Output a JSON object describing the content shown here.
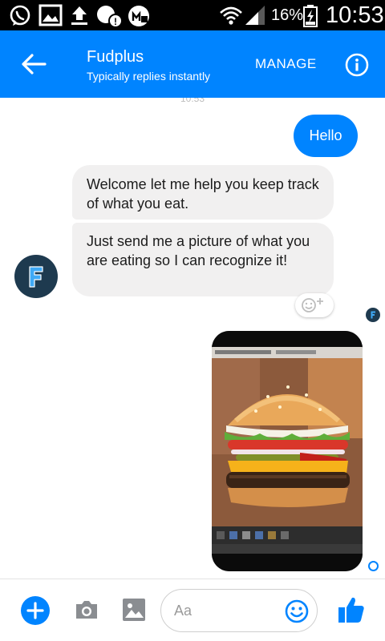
{
  "status_bar": {
    "battery": "16%",
    "time": "10:53"
  },
  "header": {
    "title": "Fudplus",
    "subtitle": "Typically replies instantly",
    "manage_label": "MANAGE"
  },
  "conversation": {
    "timestamp": "10:53",
    "messages": [
      {
        "direction": "outgoing",
        "text": "Hello"
      },
      {
        "direction": "incoming",
        "text": "Welcome let me help you keep track of what you eat."
      },
      {
        "direction": "incoming",
        "text": "Just send me a picture of what you are eating so I can recognize it!"
      }
    ],
    "avatar_letter": "F",
    "seen_avatar_letter": "F"
  },
  "composer": {
    "placeholder": "Aa"
  },
  "colors": {
    "accent": "#0084ff",
    "incoming_bubble": "#f1f0f0",
    "avatar_bg": "#1e3a4f",
    "avatar_letter": "#3fa9f5"
  },
  "icons": {
    "status_bar": [
      "whatsapp-icon",
      "gallery-icon",
      "upload-icon",
      "notification-icon",
      "app-icon",
      "wifi-icon",
      "signal-icon",
      "battery-icon"
    ],
    "header": [
      "back-arrow-icon",
      "info-icon"
    ],
    "composer": [
      "plus-icon",
      "camera-icon",
      "image-icon",
      "emoji-icon",
      "thumbs-up-icon"
    ]
  }
}
